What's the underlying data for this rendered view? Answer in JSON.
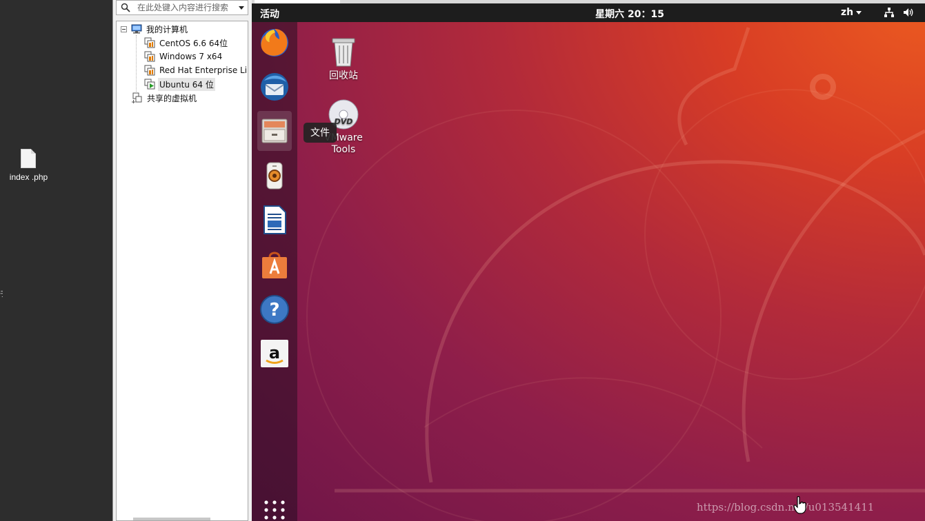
{
  "host": {
    "file_label": "index .php",
    "edge_glyph": "于"
  },
  "vm_library": {
    "search": {
      "placeholder": "在此处键入内容进行搜索"
    },
    "tree": {
      "root_label": "我的计算机",
      "vms": [
        {
          "label": "CentOS 6.6 64位"
        },
        {
          "label": "Windows 7 x64"
        },
        {
          "label": "Red Hat Enterprise Lin"
        },
        {
          "label": "Ubuntu 64 位"
        }
      ],
      "shared_label": "共享的虚拟机"
    }
  },
  "ubuntu": {
    "topbar": {
      "activities": "活动",
      "clock": "星期六 20：15",
      "language": "zh"
    },
    "dock": {
      "items": [
        "firefox-icon",
        "thunderbird-icon",
        "files-icon",
        "rhythmbox-icon",
        "libreoffice-writer-icon",
        "ubuntu-software-icon",
        "help-icon",
        "amazon-icon"
      ],
      "active_item": "files-icon"
    },
    "tooltip": "文件",
    "desktop_icons": {
      "trash_label": "回收站",
      "dvd_label_line1": "VMware",
      "dvd_label_line2": "Tools"
    },
    "watermark": "https://blog.csdn.net/u013541411"
  },
  "colors": {
    "ubuntu_orange": "#e95420",
    "ubuntu_aubergine": "#77216f",
    "topbar": "#1d1d1d"
  }
}
